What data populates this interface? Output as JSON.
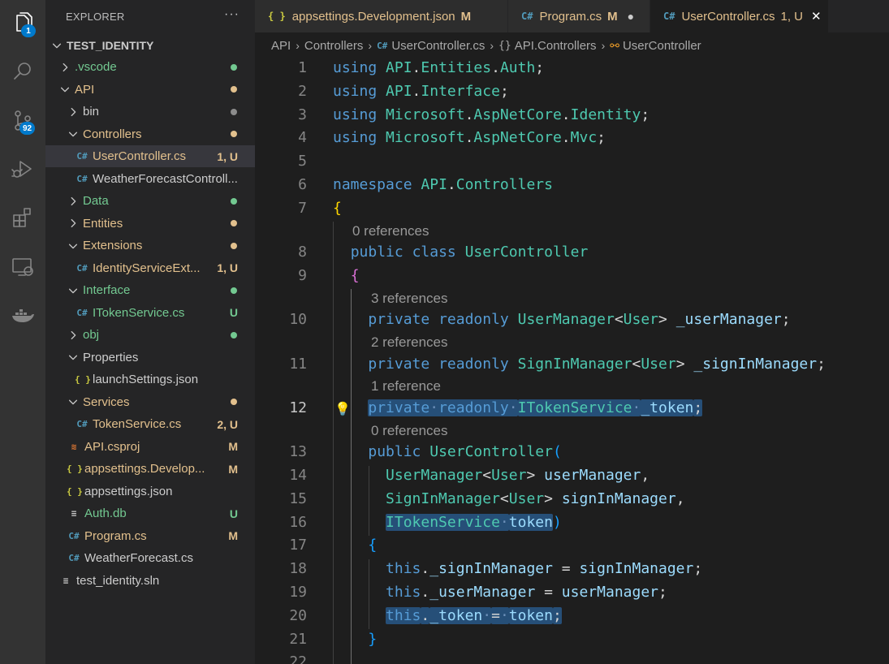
{
  "activity_bar": {
    "explorer_badge": "1",
    "scm_badge": "92",
    "items": [
      "files-icon",
      "search-icon",
      "source-control-icon",
      "run-debug-icon",
      "extensions-icon",
      "remote-explorer-icon",
      "docker-icon"
    ]
  },
  "explorer": {
    "title": "EXPLORER",
    "more": "···",
    "root": "TEST_IDENTITY",
    "rows": [
      {
        "label": ".vscode",
        "type": "folder-closed",
        "color": "#73c991",
        "dot": "#73c991"
      },
      {
        "label": "API",
        "type": "folder-open",
        "color": "#e2c08d",
        "dot": "#e2c08d"
      },
      {
        "label": "bin",
        "type": "folder-closed",
        "color": "#cccccc",
        "dot": "#8c8c8c"
      },
      {
        "label": "Controllers",
        "type": "folder-open",
        "color": "#e2c08d",
        "dot": "#e2c08d"
      },
      {
        "label": "UserController.cs",
        "type": "cs",
        "color": "#e2c08d",
        "status": "1, U",
        "status_color": "#e2c08d"
      },
      {
        "label": "WeatherForecastControll...",
        "type": "cs",
        "color": "#cccccc"
      },
      {
        "label": "Data",
        "type": "folder-closed",
        "color": "#73c991",
        "dot": "#73c991"
      },
      {
        "label": "Entities",
        "type": "folder-closed",
        "color": "#e2c08d",
        "dot": "#e2c08d"
      },
      {
        "label": "Extensions",
        "type": "folder-open",
        "color": "#e2c08d",
        "dot": "#e2c08d"
      },
      {
        "label": "IdentityServiceExt...",
        "type": "cs",
        "color": "#e2c08d",
        "status": "1, U",
        "status_color": "#e2c08d"
      },
      {
        "label": "Interface",
        "type": "folder-open",
        "color": "#73c991",
        "dot": "#73c991"
      },
      {
        "label": "ITokenService.cs",
        "type": "cs",
        "color": "#73c991",
        "status": "U",
        "status_color": "#73c991"
      },
      {
        "label": "obj",
        "type": "folder-closed",
        "color": "#73c991",
        "dot": "#73c991"
      },
      {
        "label": "Properties",
        "type": "folder-open",
        "color": "#cccccc"
      },
      {
        "label": "launchSettings.json",
        "type": "json",
        "color": "#cccccc"
      },
      {
        "label": "Services",
        "type": "folder-open",
        "color": "#e2c08d",
        "dot": "#e2c08d"
      },
      {
        "label": "TokenService.cs",
        "type": "cs",
        "color": "#e2c08d",
        "status": "2, U",
        "status_color": "#e2c08d"
      },
      {
        "label": "API.csproj",
        "type": "rss",
        "color": "#e2c08d",
        "status": "M",
        "status_color": "#e2c08d"
      },
      {
        "label": "appsettings.Develop...",
        "type": "json",
        "color": "#e2c08d",
        "status": "M",
        "status_color": "#e2c08d"
      },
      {
        "label": "appsettings.json",
        "type": "json",
        "color": "#cccccc"
      },
      {
        "label": "Auth.db",
        "type": "db",
        "color": "#73c991",
        "status": "U",
        "status_color": "#73c991"
      },
      {
        "label": "Program.cs",
        "type": "cs",
        "color": "#e2c08d",
        "status": "M",
        "status_color": "#e2c08d"
      },
      {
        "label": "WeatherForecast.cs",
        "type": "cs",
        "color": "#cccccc"
      },
      {
        "label": "test_identity.sln",
        "type": "sln",
        "color": "#cccccc"
      }
    ]
  },
  "tabs": [
    {
      "label": "appsettings.Development.json",
      "icon": "{ }",
      "mark": "M",
      "color": "#e2c08d"
    },
    {
      "label": "Program.cs",
      "icon": "C#",
      "mark": "M",
      "color": "#e2c08d",
      "dirty": "●"
    },
    {
      "label": "UserController.cs",
      "icon": "C#",
      "mark": "1, U",
      "color": "#e2c08d",
      "close": "✕"
    }
  ],
  "breadcrumbs": [
    "API",
    "Controllers",
    "UserController.cs",
    "API.Controllers",
    "UserController"
  ],
  "editor": {
    "lines": [
      {
        "n": "1",
        "tokens": [
          [
            "k",
            "using"
          ],
          [
            "p",
            " "
          ],
          [
            "t",
            "API"
          ],
          [
            "p",
            "."
          ],
          [
            "t",
            "Entities"
          ],
          [
            "p",
            "."
          ],
          [
            "t",
            "Auth"
          ],
          [
            "p",
            ";"
          ]
        ]
      },
      {
        "n": "2",
        "tokens": [
          [
            "k",
            "using"
          ],
          [
            "p",
            " "
          ],
          [
            "t",
            "API"
          ],
          [
            "p",
            "."
          ],
          [
            "t",
            "Interface"
          ],
          [
            "p",
            ";"
          ]
        ]
      },
      {
        "n": "3",
        "tokens": [
          [
            "k",
            "using"
          ],
          [
            "p",
            " "
          ],
          [
            "t",
            "Microsoft"
          ],
          [
            "p",
            "."
          ],
          [
            "t",
            "AspNetCore"
          ],
          [
            "p",
            "."
          ],
          [
            "t",
            "Identity"
          ],
          [
            "p",
            ";"
          ]
        ]
      },
      {
        "n": "4",
        "tokens": [
          [
            "k",
            "using"
          ],
          [
            "p",
            " "
          ],
          [
            "t",
            "Microsoft"
          ],
          [
            "p",
            "."
          ],
          [
            "t",
            "AspNetCore"
          ],
          [
            "p",
            "."
          ],
          [
            "t",
            "Mvc"
          ],
          [
            "p",
            ";"
          ]
        ]
      },
      {
        "n": "5",
        "tokens": []
      },
      {
        "n": "6",
        "tokens": [
          [
            "k",
            "namespace"
          ],
          [
            "p",
            " "
          ],
          [
            "t",
            "API"
          ],
          [
            "p",
            "."
          ],
          [
            "t",
            "Controllers"
          ]
        ]
      },
      {
        "n": "7",
        "tokens": [
          [
            "b1",
            "{"
          ]
        ]
      },
      {
        "lens": "0 references"
      },
      {
        "n": "8",
        "tokens": [
          [
            "p",
            "  "
          ],
          [
            "k",
            "public"
          ],
          [
            "p",
            " "
          ],
          [
            "k",
            "class"
          ],
          [
            "p",
            " "
          ],
          [
            "t",
            "UserController"
          ]
        ]
      },
      {
        "n": "9",
        "tokens": [
          [
            "p",
            "  "
          ],
          [
            "b2",
            "{"
          ]
        ]
      },
      {
        "lens": "3 references"
      },
      {
        "n": "10",
        "tokens": [
          [
            "p",
            "    "
          ],
          [
            "k",
            "private"
          ],
          [
            "p",
            " "
          ],
          [
            "k",
            "readonly"
          ],
          [
            "p",
            " "
          ],
          [
            "t",
            "UserManager"
          ],
          [
            "p",
            "<"
          ],
          [
            "t",
            "User"
          ],
          [
            "p",
            "> "
          ],
          [
            "v",
            "_userManager"
          ],
          [
            "p",
            ";"
          ]
        ]
      },
      {
        "lens": "2 references"
      },
      {
        "n": "11",
        "tokens": [
          [
            "p",
            "    "
          ],
          [
            "k",
            "private"
          ],
          [
            "p",
            " "
          ],
          [
            "k",
            "readonly"
          ],
          [
            "p",
            " "
          ],
          [
            "t",
            "SignInManager"
          ],
          [
            "p",
            "<"
          ],
          [
            "t",
            "User"
          ],
          [
            "p",
            "> "
          ],
          [
            "v",
            "_signInManager"
          ],
          [
            "p",
            ";"
          ]
        ]
      },
      {
        "lens": "1 reference"
      },
      {
        "n": "12",
        "cur": true,
        "bulb": true,
        "tokens": [
          [
            "p",
            "    "
          ],
          [
            "k hl",
            "private·readonly·"
          ],
          [
            "t hl",
            "ITokenService·"
          ],
          [
            "v hl",
            "_token"
          ],
          [
            "p hl",
            ";"
          ]
        ]
      },
      {
        "lens": "0 references"
      },
      {
        "n": "13",
        "tokens": [
          [
            "p",
            "    "
          ],
          [
            "k",
            "public"
          ],
          [
            "p",
            " "
          ],
          [
            "t",
            "UserController"
          ],
          [
            "b3",
            "("
          ]
        ]
      },
      {
        "n": "14",
        "tokens": [
          [
            "p",
            "      "
          ],
          [
            "t",
            "UserManager"
          ],
          [
            "p",
            "<"
          ],
          [
            "t",
            "User"
          ],
          [
            "p",
            "> "
          ],
          [
            "v",
            "userManager"
          ],
          [
            "p",
            ","
          ]
        ]
      },
      {
        "n": "15",
        "tokens": [
          [
            "p",
            "      "
          ],
          [
            "t",
            "SignInManager"
          ],
          [
            "p",
            "<"
          ],
          [
            "t",
            "User"
          ],
          [
            "p",
            "> "
          ],
          [
            "v",
            "signInManager"
          ],
          [
            "p",
            ","
          ]
        ]
      },
      {
        "n": "16",
        "tokens": [
          [
            "p",
            "      "
          ],
          [
            "t hl",
            "ITokenService·"
          ],
          [
            "v hl",
            "token"
          ],
          [
            "b3",
            ")"
          ]
        ]
      },
      {
        "n": "17",
        "tokens": [
          [
            "p",
            "    "
          ],
          [
            "b3",
            "{"
          ]
        ]
      },
      {
        "n": "18",
        "tokens": [
          [
            "p",
            "      "
          ],
          [
            "k",
            "this"
          ],
          [
            "p",
            "."
          ],
          [
            "v",
            "_signInManager"
          ],
          [
            "p",
            " = "
          ],
          [
            "v",
            "signInManager"
          ],
          [
            "p",
            ";"
          ]
        ]
      },
      {
        "n": "19",
        "tokens": [
          [
            "p",
            "      "
          ],
          [
            "k",
            "this"
          ],
          [
            "p",
            "."
          ],
          [
            "v",
            "_userManager"
          ],
          [
            "p",
            " = "
          ],
          [
            "v",
            "userManager"
          ],
          [
            "p",
            ";"
          ]
        ]
      },
      {
        "n": "20",
        "tokens": [
          [
            "p",
            "      "
          ],
          [
            "k hl",
            "this"
          ],
          [
            "p hl",
            "."
          ],
          [
            "v hl",
            "_token·"
          ],
          [
            "p hl",
            "=·"
          ],
          [
            "v hl",
            "token"
          ],
          [
            "p hl",
            ";"
          ]
        ]
      },
      {
        "n": "21",
        "tokens": [
          [
            "p",
            "    "
          ],
          [
            "b3",
            "}"
          ]
        ]
      },
      {
        "n": "22",
        "tokens": []
      }
    ]
  }
}
